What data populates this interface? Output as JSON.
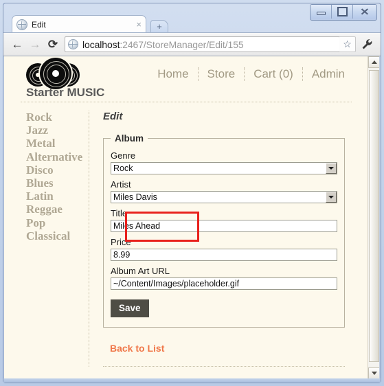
{
  "browser": {
    "tab": {
      "title": "Edit",
      "favicon": "globe-icon",
      "close": "×"
    },
    "new_tab": "+",
    "nav": {
      "back": "←",
      "forward": "→",
      "reload": "⟳"
    },
    "address": {
      "host": "localhost",
      "path": ":2467/StoreManager/Edit/155",
      "favicon": "globe-icon"
    },
    "bookmark_star": "☆",
    "wrench": "wrench-icon",
    "window_controls": {
      "minimize": "minimize",
      "maximize": "maximize",
      "close": "✕"
    }
  },
  "site": {
    "logo": "three-vinyl-records-logo",
    "title": "Starter MUSIC",
    "nav": [
      {
        "label": "Home"
      },
      {
        "label": "Store"
      },
      {
        "label": "Cart (0)"
      },
      {
        "label": "Admin"
      }
    ]
  },
  "sidebar": {
    "genres": [
      {
        "label": "Rock"
      },
      {
        "label": "Jazz"
      },
      {
        "label": "Metal"
      },
      {
        "label": "Alternative"
      },
      {
        "label": "Disco"
      },
      {
        "label": "Blues"
      },
      {
        "label": "Latin"
      },
      {
        "label": "Reggae"
      },
      {
        "label": "Pop"
      },
      {
        "label": "Classical"
      }
    ]
  },
  "main": {
    "heading": "Edit",
    "fieldset_legend": "Album",
    "fields": {
      "genre": {
        "label": "Genre",
        "value": "Rock"
      },
      "artist": {
        "label": "Artist",
        "value": "Miles Davis"
      },
      "title": {
        "label": "Title",
        "value": "Miles Ahead"
      },
      "price": {
        "label": "Price",
        "value": "8.99"
      },
      "album_art_url": {
        "label": "Album Art URL",
        "value": "~/Content/Images/placeholder.gif"
      }
    },
    "save_label": "Save",
    "back_link": "Back to List"
  },
  "annotation": {
    "highlight_color": "#e8211c",
    "target": "genre-field"
  },
  "colors": {
    "page_background": "#fdf9ec",
    "sidebar_link": "#b0a894",
    "nav_link": "#a29a84",
    "back_link": "#f0784a",
    "save_button": "#4e4d45"
  }
}
